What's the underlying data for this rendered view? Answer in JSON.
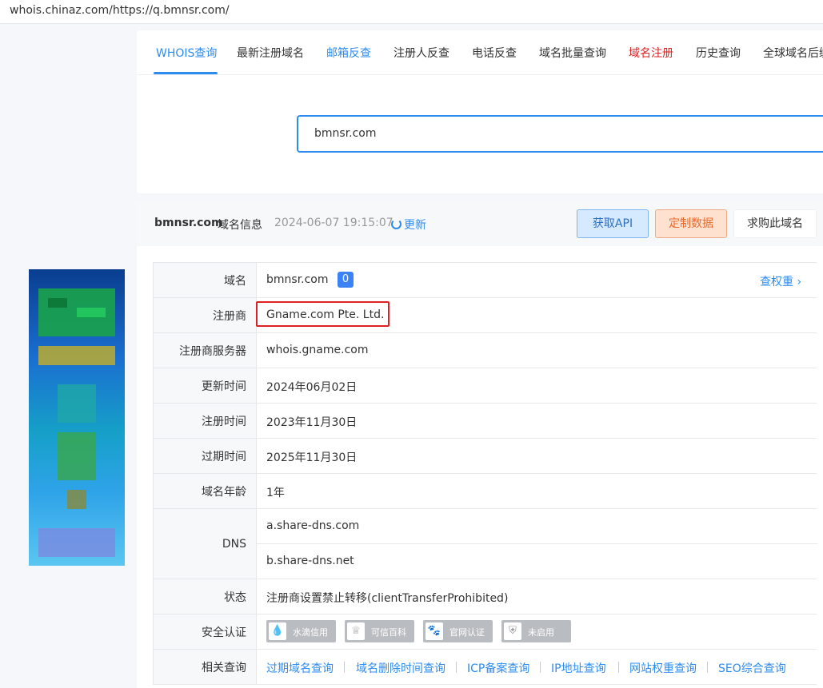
{
  "browser": {
    "url": "whois.chinaz.com/https://q.bmnsr.com/"
  },
  "tabs": [
    {
      "label": "WHOIS查询"
    },
    {
      "label": "最新注册域名"
    },
    {
      "label": "邮箱反查"
    },
    {
      "label": "注册人反查"
    },
    {
      "label": "电话反查"
    },
    {
      "label": "域名批量查询"
    },
    {
      "label": "域名注册"
    },
    {
      "label": "历史查询"
    },
    {
      "label": "全球域名后缀"
    }
  ],
  "search": {
    "value": "bmnsr.com"
  },
  "info": {
    "domain": "bmnsr.com",
    "suffix": "域名信息",
    "timestamp": "2024-06-07 19:15:07",
    "refresh": "更新",
    "btn_api": "获取API",
    "btn_custom": "定制数据",
    "btn_buy": "求购此域名"
  },
  "rows": {
    "domain": {
      "label": "域名",
      "value": "bmnsr.com",
      "badge": "0",
      "link": "查权重"
    },
    "registrar": {
      "label": "注册商",
      "value": "Gname.com Pte. Ltd."
    },
    "server": {
      "label": "注册商服务器",
      "value": "whois.gname.com"
    },
    "updated": {
      "label": "更新时间",
      "value": "2024年06月02日"
    },
    "created": {
      "label": "注册时间",
      "value": "2023年11月30日"
    },
    "expires": {
      "label": "过期时间",
      "value": "2025年11月30日"
    },
    "age": {
      "label": "域名年龄",
      "value": "1年"
    },
    "dns": {
      "label": "DNS",
      "values": [
        "a.share-dns.com",
        "b.share-dns.net"
      ]
    },
    "status": {
      "label": "状态",
      "value": "注册商设置禁止转移(clientTransferProhibited)"
    },
    "security": {
      "label": "安全认证",
      "items": [
        "水滴信用",
        "可信百科",
        "官网认证",
        "未启用"
      ]
    },
    "related": {
      "label": "相关查询",
      "links": [
        "过期域名查询",
        "域名删除时间查询",
        "ICP备案查询",
        "IP地址查询",
        "网站权重查询",
        "SEO综合查询"
      ]
    }
  },
  "colors": {
    "accent": "#2d8cf0",
    "highlight": "#e02020"
  }
}
